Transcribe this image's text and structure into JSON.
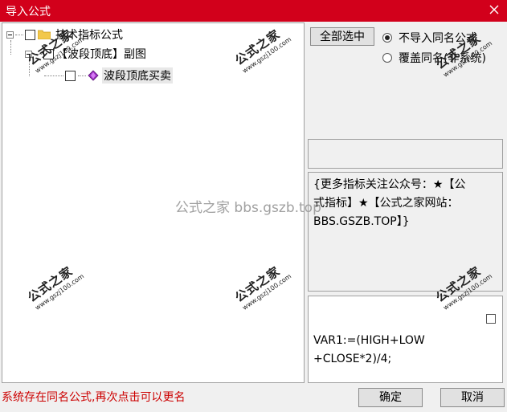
{
  "window": {
    "title": "导入公式",
    "close_icon": "close-icon"
  },
  "tree": {
    "root": {
      "label": "技术指标公式",
      "checked": false,
      "expanded": true
    },
    "child": {
      "label": "【波段顶底】副图",
      "checked": false,
      "expanded": true
    },
    "leaf": {
      "label": "波段顶底买卖",
      "checked": false
    }
  },
  "buttons": {
    "select_all": "全部选中",
    "ok": "确定",
    "cancel": "取消"
  },
  "options": {
    "skip_same_name": "不导入同名公式",
    "overwrite_same_name": "覆盖同名(非系统)",
    "selected": "skip_same_name"
  },
  "description": [
    "{更多指标关注公众号：★【公",
    "式指标】★【公式之家网站：",
    "BBS.GSZB.TOP】}"
  ],
  "code": {
    "line1": "VAR1:=(HIGH+LOW",
    "line2": "+CLOSE*2)/4;"
  },
  "status_message": "系统存在同名公式,再次点击可以更名",
  "watermark": {
    "center_text": "公式之家 bbs.gszb.top",
    "stamp_text": "公式之家",
    "stamp_url": "www.gszj100.com"
  },
  "colors": {
    "title_bar": "#d2001b",
    "status_text": "#cc0000"
  }
}
